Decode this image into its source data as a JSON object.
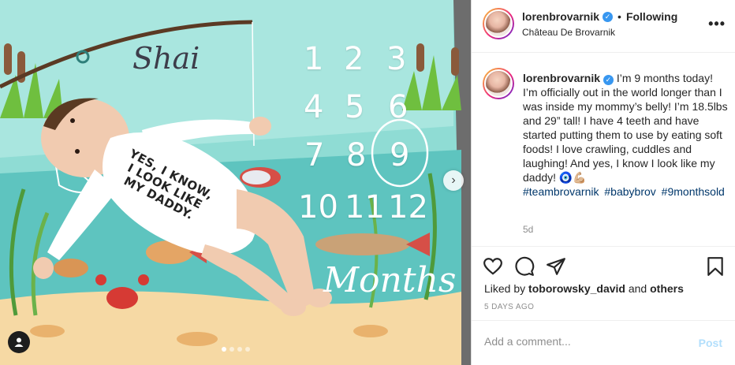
{
  "photo": {
    "blanket_name": "Shai",
    "numbers": [
      "1",
      "2",
      "3",
      "4",
      "5",
      "6",
      "7",
      "8",
      "9",
      "10",
      "11",
      "12"
    ],
    "months_word": "Months",
    "onesie_text": "YES, I KNOW, I LOOK LIKE MY DADDY.",
    "carousel_count": 4,
    "carousel_active": 1
  },
  "header": {
    "username": "lorenbrovarnik",
    "separator": "•",
    "follow_status": "Following",
    "location": "Château De Brovarnik",
    "more": "•••"
  },
  "caption": {
    "username": "lorenbrovarnik",
    "text": "I’m 9 months today! I’m officially out in the world longer than I was inside my mommy’s belly! I’m 18.5lbs and 29” tall! I have 4 teeth and have started putting them to use by eating soft foods! I love crawling, cuddles and laughing! And yes, I know I look like my daddy! 🧿💪🏼",
    "hashtags": [
      "#teambrovarnik",
      "#babybrov",
      "#9monthsold"
    ],
    "age": "5d"
  },
  "likes": {
    "prefix": "Liked by",
    "user": "toborowsky_david",
    "conjunction": "and",
    "others": "others"
  },
  "timestamp": "5 DAYS AGO",
  "comment": {
    "placeholder": "Add a comment...",
    "post_label": "Post"
  },
  "colors": {
    "link": "#00376b",
    "verified": "#3897f0",
    "post_disabled": "#b2dffc"
  }
}
